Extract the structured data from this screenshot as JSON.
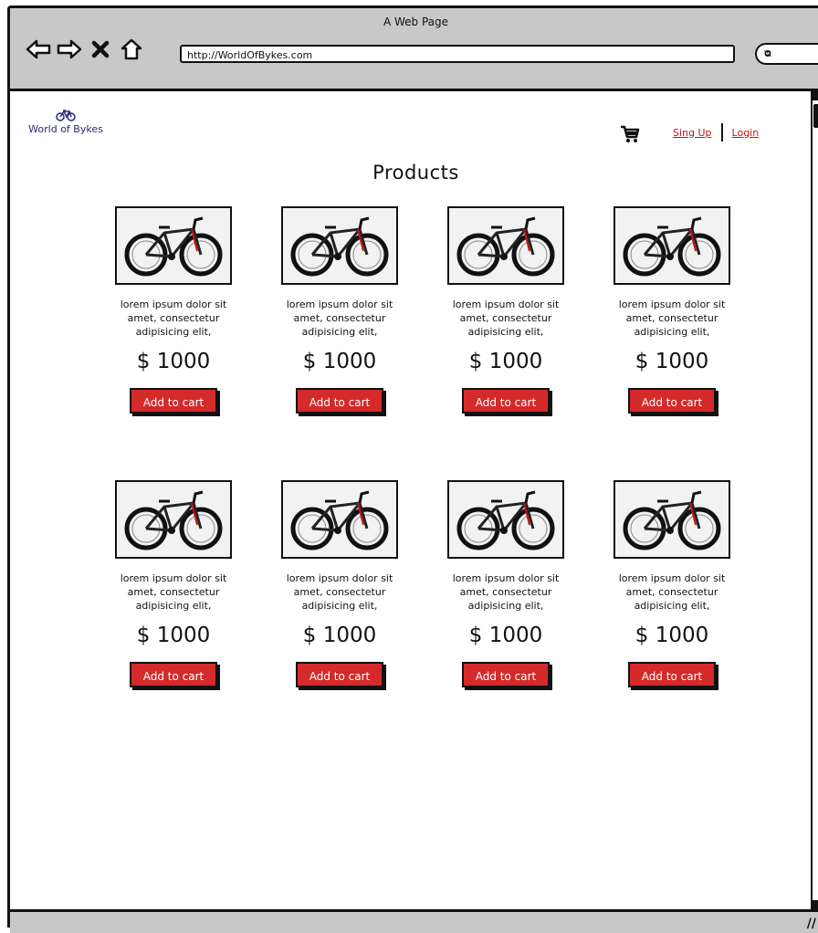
{
  "window": {
    "title": "A Web Page"
  },
  "browser": {
    "url": "http://WorldOfBykes.com"
  },
  "header": {
    "logo_text": "World of Bykes",
    "signup_label": "Sing Up",
    "login_label": "Login"
  },
  "page": {
    "title": "Products"
  },
  "products": [
    {
      "description": "lorem ipsum dolor sit amet, consectetur adipisicing elit,",
      "price": "$ 1000",
      "button": "Add to cart"
    },
    {
      "description": "lorem ipsum dolor sit amet, consectetur adipisicing elit,",
      "price": "$ 1000",
      "button": "Add to cart"
    },
    {
      "description": "lorem ipsum dolor sit amet, consectetur adipisicing elit,",
      "price": "$ 1000",
      "button": "Add to cart"
    },
    {
      "description": "lorem ipsum dolor sit amet, consectetur adipisicing elit,",
      "price": "$ 1000",
      "button": "Add to cart"
    },
    {
      "description": "lorem ipsum dolor sit amet, consectetur adipisicing elit,",
      "price": "$ 1000",
      "button": "Add to cart"
    },
    {
      "description": "lorem ipsum dolor sit amet, consectetur adipisicing elit,",
      "price": "$ 1000",
      "button": "Add to cart"
    },
    {
      "description": "lorem ipsum dolor sit amet, consectetur adipisicing elit,",
      "price": "$ 1000",
      "button": "Add to cart"
    },
    {
      "description": "lorem ipsum dolor sit amet, consectetur adipisicing elit,",
      "price": "$ 1000",
      "button": "Add to cart"
    }
  ],
  "icons": {
    "back": "back-arrow-icon",
    "forward": "forward-arrow-icon",
    "stop": "close-icon",
    "home": "home-icon",
    "search": "search-icon",
    "cart": "shopping-cart-icon",
    "logo": "bicycle-icon"
  },
  "colors": {
    "accent_red": "#d42a2a",
    "link_red": "#cc1111",
    "logo_blue": "#2a2a7a",
    "chrome_gray": "#c8c8c8"
  }
}
